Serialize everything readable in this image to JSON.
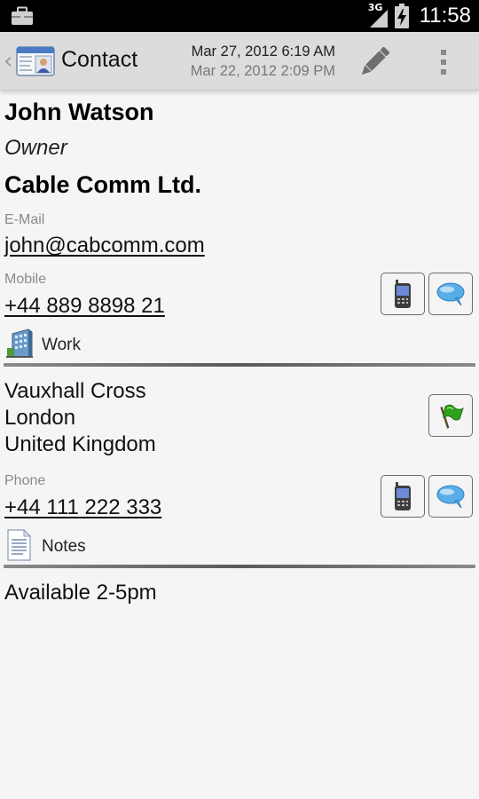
{
  "status_bar": {
    "network": "3G",
    "time": "11:58"
  },
  "action_bar": {
    "title": "Contact",
    "date_modified": "Mar 27, 2012 6:19 AM",
    "date_created": "Mar 22, 2012 2:09 PM"
  },
  "contact": {
    "name": "John Watson",
    "job_title": "Owner",
    "company": "Cable Comm Ltd.",
    "email_label": "E-Mail",
    "email": "john@cabcomm.com",
    "mobile_label": "Mobile",
    "mobile": "+44 889 8898 21"
  },
  "work": {
    "section_label": "Work",
    "address_line1": "Vauxhall Cross",
    "address_line2": "London",
    "address_line3": "United Kingdom",
    "phone_label": "Phone",
    "phone": "+44 111 222 333"
  },
  "notes": {
    "section_label": "Notes",
    "text": "Available 2-5pm"
  },
  "colors": {
    "action_bar_bg": "#dcdcdc",
    "page_bg": "#f5f5f5",
    "divider": "#6a6a6a",
    "message_bubble": "#5aaee8",
    "flag_green": "#2ea21b"
  }
}
